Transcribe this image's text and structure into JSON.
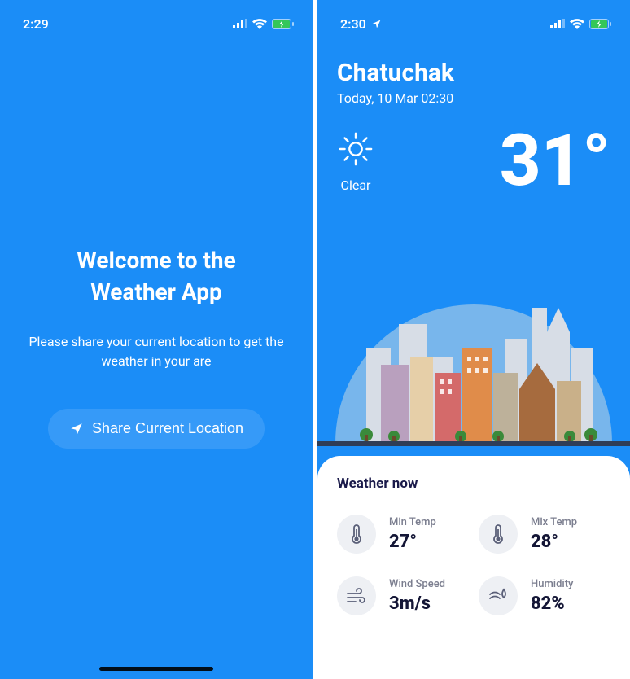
{
  "screen1": {
    "status_time": "2:29",
    "title_line1": "Welcome to the",
    "title_line2": "Weather App",
    "subtitle": "Please share your current location to get the weather in your are",
    "share_button": "Share Current Location"
  },
  "screen2": {
    "status_time": "2:30",
    "location": "Chatuchak",
    "date": "Today, 10 Mar 02:30",
    "condition": "Clear",
    "temp": "31°",
    "card_title": "Weather now",
    "metrics": {
      "min_temp_label": "Min Temp",
      "min_temp_value": "27°",
      "max_temp_label": "Mix Temp",
      "max_temp_value": "28°",
      "wind_label": "Wind Speed",
      "wind_value": "3m/s",
      "humidity_label": "Humidity",
      "humidity_value": "82%"
    }
  },
  "icons": {
    "location_arrow": "location-arrow-icon",
    "sun": "sun-icon",
    "thermometer": "thermometer-icon",
    "wind": "wind-icon",
    "humidity": "humidity-icon",
    "signal": "cellular-signal-icon",
    "wifi": "wifi-icon",
    "battery": "battery-charging-icon"
  }
}
